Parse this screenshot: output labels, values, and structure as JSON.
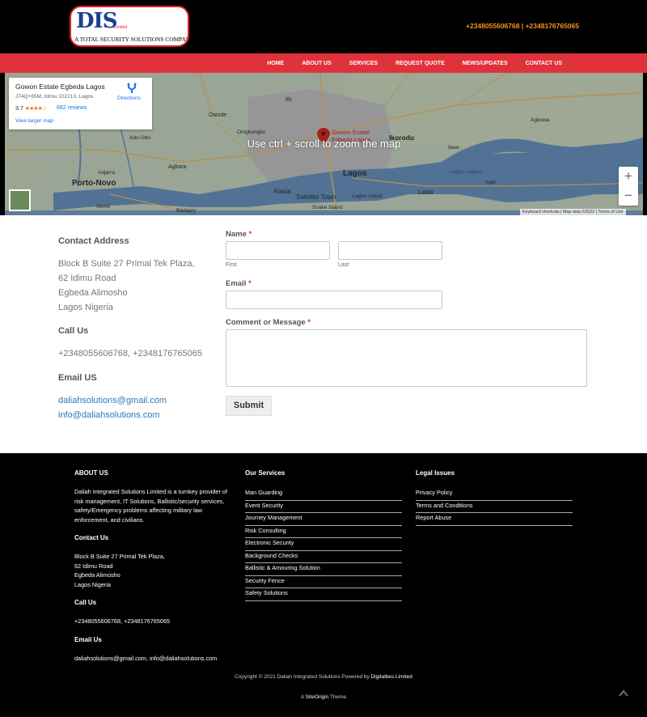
{
  "header": {
    "logo_mark": "DIS",
    "logo_sub": "Limited",
    "logo_tagline": "A TOTAL SECURITY SOLUTIONS COMPANY",
    "phones": "+2348055606768 | +2348176765065"
  },
  "nav": {
    "items": [
      "HOME",
      "ABOUT US",
      "SERVICES",
      "REQUEST QUOTE",
      "NEWS/UPDATES",
      "CONTACT US"
    ]
  },
  "map": {
    "place_name": "Gowon Estate Egbeda Lagos",
    "address": "J74Q+65M, Idimu 102213, Lagos",
    "rating": "3.7",
    "stars": "★★★★☆",
    "reviews": "682 reviews",
    "directions": "Directions",
    "larger_map": "View larger map",
    "hint": "Use ctrl + scroll to zoom the map",
    "zoom_in": "+",
    "zoom_out": "−",
    "footer": "Keyboard shortcuts  |  Map data ©2022  |  Terms of Use",
    "labels": {
      "owode": "Owode",
      "ifo": "Ifo",
      "onigbongbo": "Onigbongbo",
      "ikorodu": "Ikorodu",
      "pin_label_1": "Gowon Estate",
      "pin_label_2": "Egbeda Lagos",
      "ado_odo": "Ado-Odo",
      "agbara": "Agbara",
      "porto_novo": "Porto-Novo",
      "lagos": "Lagos",
      "alasia": "Alasia",
      "satellite_town": "Satellite Town",
      "lagos_island": "Lagos Island",
      "lekki": "Lekki",
      "snake_island": "Snake Island",
      "badagry": "Badagry",
      "lagos_lagoon": "Lagos Lagoon",
      "adjarra": "Adjarra",
      "seme": "Sèmè",
      "ilase": "Ilase",
      "agbowa": "Agbowa",
      "ajah": "Ajah"
    }
  },
  "contact": {
    "address_heading": "Contact Address",
    "address_lines": [
      "Block B Suite 27 Primal Tek Plaza,",
      "62 Idimu Road",
      "Egbeda Alimosho",
      "Lagos Nigeria"
    ],
    "call_heading": "Call Us",
    "phones": "+2348055606768, +2348176765065",
    "email_heading": "Email US",
    "emails": [
      "daliahsolutions@gmail.com",
      "info@daliahsolutions.com"
    ]
  },
  "form": {
    "name_label": "Name",
    "first_label": "First",
    "last_label": "Last",
    "email_label": "Email",
    "message_label": "Comment or Message",
    "required_mark": "*",
    "submit_label": "Submit"
  },
  "footer": {
    "about_heading": "ABOUT US",
    "about_text": "Daliah Integrated Solutions Limited is a turnkey provider of risk management, IT Solutions, Ballistic/security services, safety/Emergency problems affecting military law enforcement, and civilians.",
    "contact_heading": "Contact Us",
    "contact_lines": [
      "Block B Suite 27 Primal Tek Plaza,",
      "62 Idimu Road",
      "Egbeda Alimosho",
      "Lagos Nigeria"
    ],
    "call_heading": "Call Us",
    "phones": "+2348055606768, +2348176765065",
    "email_heading": "Email Us",
    "emails": "daliahsolutions@gmail.com, info@daliahsolutions.com",
    "services_heading": "Our Services",
    "services": [
      "Man Guarding",
      "Event Security",
      "Journey Management",
      "Risk Consulting",
      "Electronic Security",
      "Background Checks",
      "Ballistic & Amouring Solution",
      "Security Fence",
      "Safety Solutions"
    ],
    "legal_heading": "Legal Issues",
    "legal": [
      "Privacy Policy",
      "Terms and Conditions",
      "Report Abuse"
    ],
    "copyright_prefix": "Copyright © 2021 Daliah Integrated Solutions Powered by",
    "copyright_brand": "Digitalbes Limited",
    "theme_prefix": "A",
    "theme_brand": "SiteOrigin",
    "theme_suffix": "Theme"
  },
  "colors": {
    "nav_red": "#e0323b",
    "phone_orange": "#f7941d",
    "link_blue": "#2a7ab9"
  }
}
